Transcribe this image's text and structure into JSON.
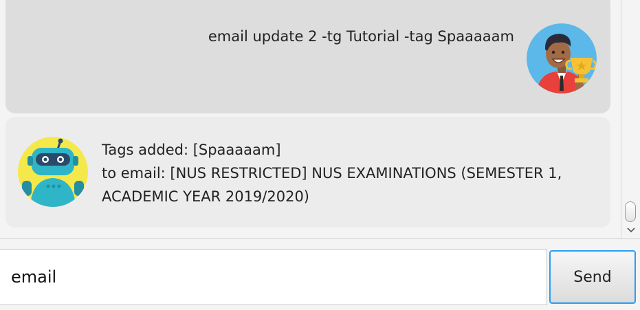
{
  "messages": {
    "user": {
      "text": "email update 2 -tg Tutorial -tag Spaaaaam",
      "avatar_icon": "user-trophy-avatar-icon"
    },
    "bot": {
      "line1": "Tags added: [Spaaaaam]",
      "line2": "to email: [NUS RESTRICTED] NUS EXAMINATIONS (SEMESTER 1,",
      "line3": "ACADEMIC YEAR 2019/2020)",
      "avatar_icon": "robot-avatar-icon"
    }
  },
  "input": {
    "value": "email"
  },
  "send": {
    "label": "Send"
  },
  "colors": {
    "accent": "#2a9df4",
    "user_bubble": "#dddddd",
    "bot_bubble": "#ececec"
  }
}
